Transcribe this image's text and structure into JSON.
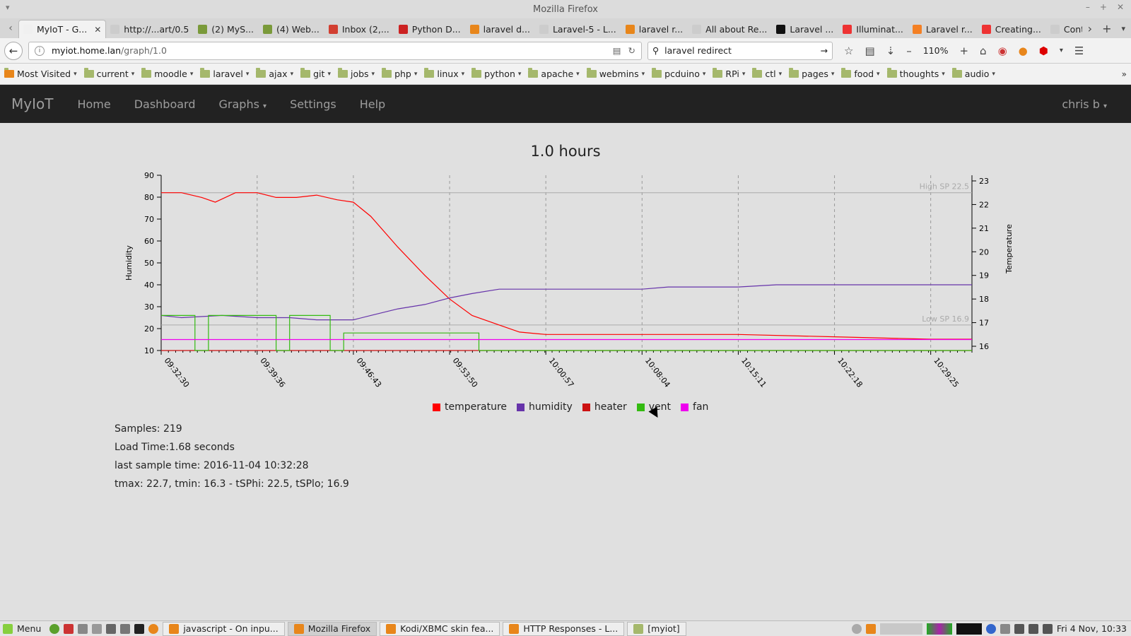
{
  "window": {
    "title": "Mozilla Firefox"
  },
  "tabs": [
    {
      "label": "MyIoT - G...",
      "active": true,
      "color": "#f0f0f0"
    },
    {
      "label": "http://...art/0.5",
      "color": "#cccccc"
    },
    {
      "label": "(2) MyS...",
      "color": "#7a9a3a"
    },
    {
      "label": "(4) Web...",
      "color": "#7a9a3a"
    },
    {
      "label": "Inbox (2,...",
      "color": "#d23f31"
    },
    {
      "label": "Python D...",
      "color": "#cc2222"
    },
    {
      "label": "laravel d...",
      "color": "#e8861b"
    },
    {
      "label": "Laravel-5 - L...",
      "color": "#cccccc"
    },
    {
      "label": "laravel r...",
      "color": "#e8861b"
    },
    {
      "label": "All about Re...",
      "color": "#cccccc"
    },
    {
      "label": "Laravel ...",
      "color": "#111111"
    },
    {
      "label": "Illuminat...",
      "color": "#e33"
    },
    {
      "label": "Laravel r...",
      "color": "#f48024"
    },
    {
      "label": "Creating...",
      "color": "#e33"
    },
    {
      "label": "Controll...",
      "color": "#cccccc"
    }
  ],
  "navbar": {
    "url_host": "myiot.home.lan",
    "url_path": "/graph/1.0",
    "search_value": "laravel redirect",
    "zoom": "110%"
  },
  "bookmarks": [
    "Most Visited",
    "current",
    "moodle",
    "laravel",
    "ajax",
    "git",
    "jobs",
    "php",
    "linux",
    "python",
    "apache",
    "webmins",
    "pcduino",
    "RPi",
    "ctl",
    "pages",
    "food",
    "thoughts",
    "audio"
  ],
  "app_nav": {
    "brand": "MyIoT",
    "items": [
      "Home",
      "Dashboard",
      "Graphs",
      "Settings",
      "Help"
    ],
    "user": "chris b"
  },
  "chart_data": {
    "type": "line",
    "title": "1.0 hours",
    "ylabel": "Humidity",
    "y2label": "Temperature",
    "ylim": [
      10,
      90
    ],
    "y2lim": [
      16,
      23
    ],
    "yticks": [
      10,
      20,
      30,
      40,
      50,
      60,
      70,
      80,
      90
    ],
    "y2ticks": [
      16,
      17,
      18,
      19,
      20,
      21,
      22,
      23
    ],
    "xlim": [
      "09:32:30",
      "10:32:28"
    ],
    "xticks": [
      "09:32:30",
      "09:39:36",
      "09:46:43",
      "09:53:50",
      "10:00:57",
      "10:08:04",
      "10:15:11",
      "10:22:18",
      "10:29:25"
    ],
    "hlines": [
      {
        "label": "High SP 22.5",
        "value": 22.5,
        "axis": "temperature"
      },
      {
        "label": "Low SP 16.9",
        "value": 16.9,
        "axis": "temperature"
      }
    ],
    "series": [
      {
        "name": "temperature",
        "color": "#ff0000",
        "axis": "temperature",
        "points": [
          [
            "09:32:30",
            22.5
          ],
          [
            "09:34:00",
            22.5
          ],
          [
            "09:35:30",
            22.3
          ],
          [
            "09:36:30",
            22.1
          ],
          [
            "09:38:00",
            22.5
          ],
          [
            "09:39:36",
            22.5
          ],
          [
            "09:41:00",
            22.3
          ],
          [
            "09:42:30",
            22.3
          ],
          [
            "09:44:00",
            22.4
          ],
          [
            "09:45:30",
            22.2
          ],
          [
            "09:46:43",
            22.1
          ],
          [
            "09:48:00",
            21.5
          ],
          [
            "09:50:00",
            20.2
          ],
          [
            "09:52:00",
            19.0
          ],
          [
            "09:53:50",
            18.0
          ],
          [
            "09:55:30",
            17.3
          ],
          [
            "09:57:30",
            16.9
          ],
          [
            "09:59:00",
            16.6
          ],
          [
            "10:00:57",
            16.5
          ],
          [
            "10:08:04",
            16.5
          ],
          [
            "10:15:11",
            16.5
          ],
          [
            "10:22:18",
            16.4
          ],
          [
            "10:29:25",
            16.3
          ],
          [
            "10:32:28",
            16.3
          ]
        ]
      },
      {
        "name": "humidity",
        "color": "#6633aa",
        "axis": "humidity",
        "points": [
          [
            "09:32:30",
            26
          ],
          [
            "09:34:00",
            25
          ],
          [
            "09:37:00",
            26
          ],
          [
            "09:39:36",
            25
          ],
          [
            "09:42:00",
            25
          ],
          [
            "09:44:00",
            24
          ],
          [
            "09:46:43",
            24
          ],
          [
            "09:48:00",
            26
          ],
          [
            "09:50:00",
            29
          ],
          [
            "09:52:00",
            31
          ],
          [
            "09:53:50",
            34
          ],
          [
            "09:55:30",
            36
          ],
          [
            "09:57:30",
            38
          ],
          [
            "09:59:00",
            38
          ],
          [
            "10:00:57",
            38
          ],
          [
            "10:08:04",
            38
          ],
          [
            "10:10:00",
            39
          ],
          [
            "10:15:11",
            39
          ],
          [
            "10:18:00",
            40
          ],
          [
            "10:22:18",
            40
          ],
          [
            "10:29:25",
            40
          ],
          [
            "10:32:28",
            40
          ]
        ]
      },
      {
        "name": "heater",
        "color": "#cc1111",
        "axis": "humidity",
        "points": [
          [
            "09:32:30",
            10
          ],
          [
            "10:32:28",
            10
          ]
        ]
      },
      {
        "name": "vent",
        "color": "#33bb11",
        "axis": "humidity",
        "points": [
          [
            "09:32:30",
            26
          ],
          [
            "09:35:00",
            26
          ],
          [
            "09:35:00",
            10
          ],
          [
            "09:36:00",
            10
          ],
          [
            "09:36:00",
            26
          ],
          [
            "09:41:00",
            26
          ],
          [
            "09:41:00",
            10
          ],
          [
            "09:42:00",
            10
          ],
          [
            "09:42:00",
            26
          ],
          [
            "09:45:00",
            26
          ],
          [
            "09:45:00",
            10
          ],
          [
            "09:46:00",
            10
          ],
          [
            "09:46:00",
            18
          ],
          [
            "09:56:00",
            18
          ],
          [
            "09:56:00",
            10
          ],
          [
            "10:32:28",
            10
          ]
        ]
      },
      {
        "name": "fan",
        "color": "#ee00ee",
        "axis": "humidity",
        "points": [
          [
            "09:32:30",
            15
          ],
          [
            "10:32:28",
            15
          ]
        ]
      }
    ],
    "legend": [
      "temperature",
      "humidity",
      "heater",
      "vent",
      "fan"
    ],
    "legend_placement": "bottom-center",
    "grid": true
  },
  "stats": [
    "Samples: 219",
    "Load Time:1.68 seconds",
    "last sample time: 2016-11-04 10:32:28",
    "tmax: 22.7, tmin: 16.3 - tSPhi: 22.5, tSPlo; 16.9"
  ],
  "taskbar": {
    "menu": "Menu",
    "tasks": [
      {
        "label": "javascript - On inpu...",
        "active": false,
        "color": "#e8861b"
      },
      {
        "label": "Mozilla Firefox",
        "active": true,
        "color": "#e8861b"
      },
      {
        "label": "Kodi/XBMC skin fea...",
        "active": false,
        "color": "#e8861b"
      },
      {
        "label": "HTTP Responses - L...",
        "active": false,
        "color": "#e8861b"
      },
      {
        "label": "[myiot]",
        "active": false,
        "color": "#a5b86c"
      }
    ],
    "clock": "Fri 4 Nov, 10:33"
  }
}
